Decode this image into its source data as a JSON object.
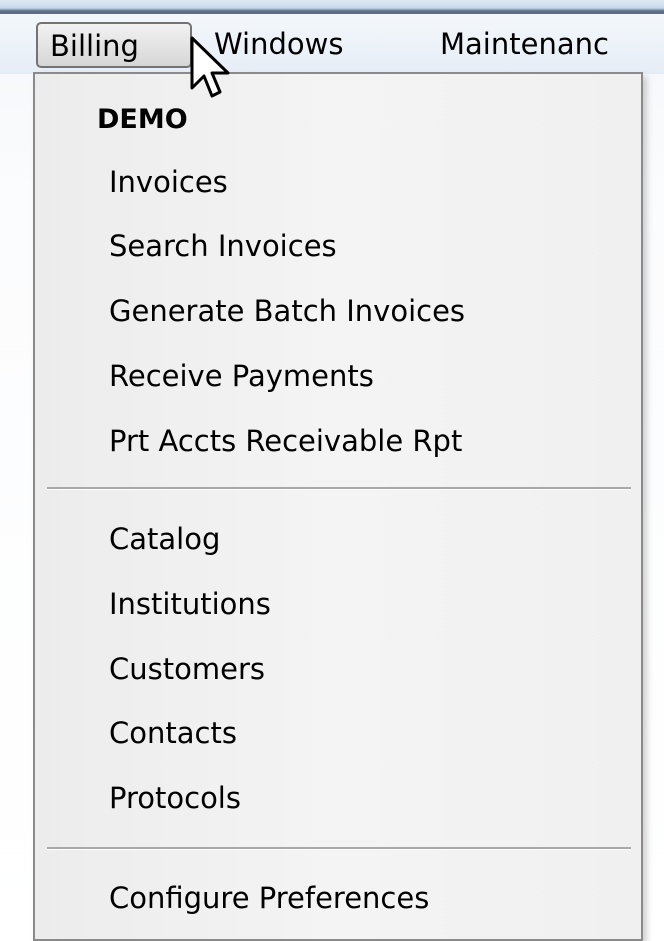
{
  "menubar": {
    "items": [
      {
        "label": "Billing",
        "state": "open"
      },
      {
        "label": "Windows"
      },
      {
        "label": "Maintenanc"
      }
    ]
  },
  "dropdown": {
    "header": "DEMO",
    "group1": [
      {
        "label": "Invoices"
      },
      {
        "label": "Search Invoices"
      },
      {
        "label": "Generate Batch Invoices"
      },
      {
        "label": "Receive Payments"
      },
      {
        "label": "Prt Accts Receivable Rpt"
      }
    ],
    "group2": [
      {
        "label": "Catalog"
      },
      {
        "label": "Institutions"
      },
      {
        "label": "Customers"
      },
      {
        "label": "Contacts"
      },
      {
        "label": "Protocols"
      }
    ],
    "group3": [
      {
        "label": "Configure Preferences"
      }
    ]
  },
  "icons": {
    "cursor": "mouse-pointer-icon"
  },
  "colors": {
    "menu_background": "#f0f0f0",
    "menu_border": "#8a8a8a",
    "separator": "#a8a8a8",
    "text": "#000000"
  }
}
